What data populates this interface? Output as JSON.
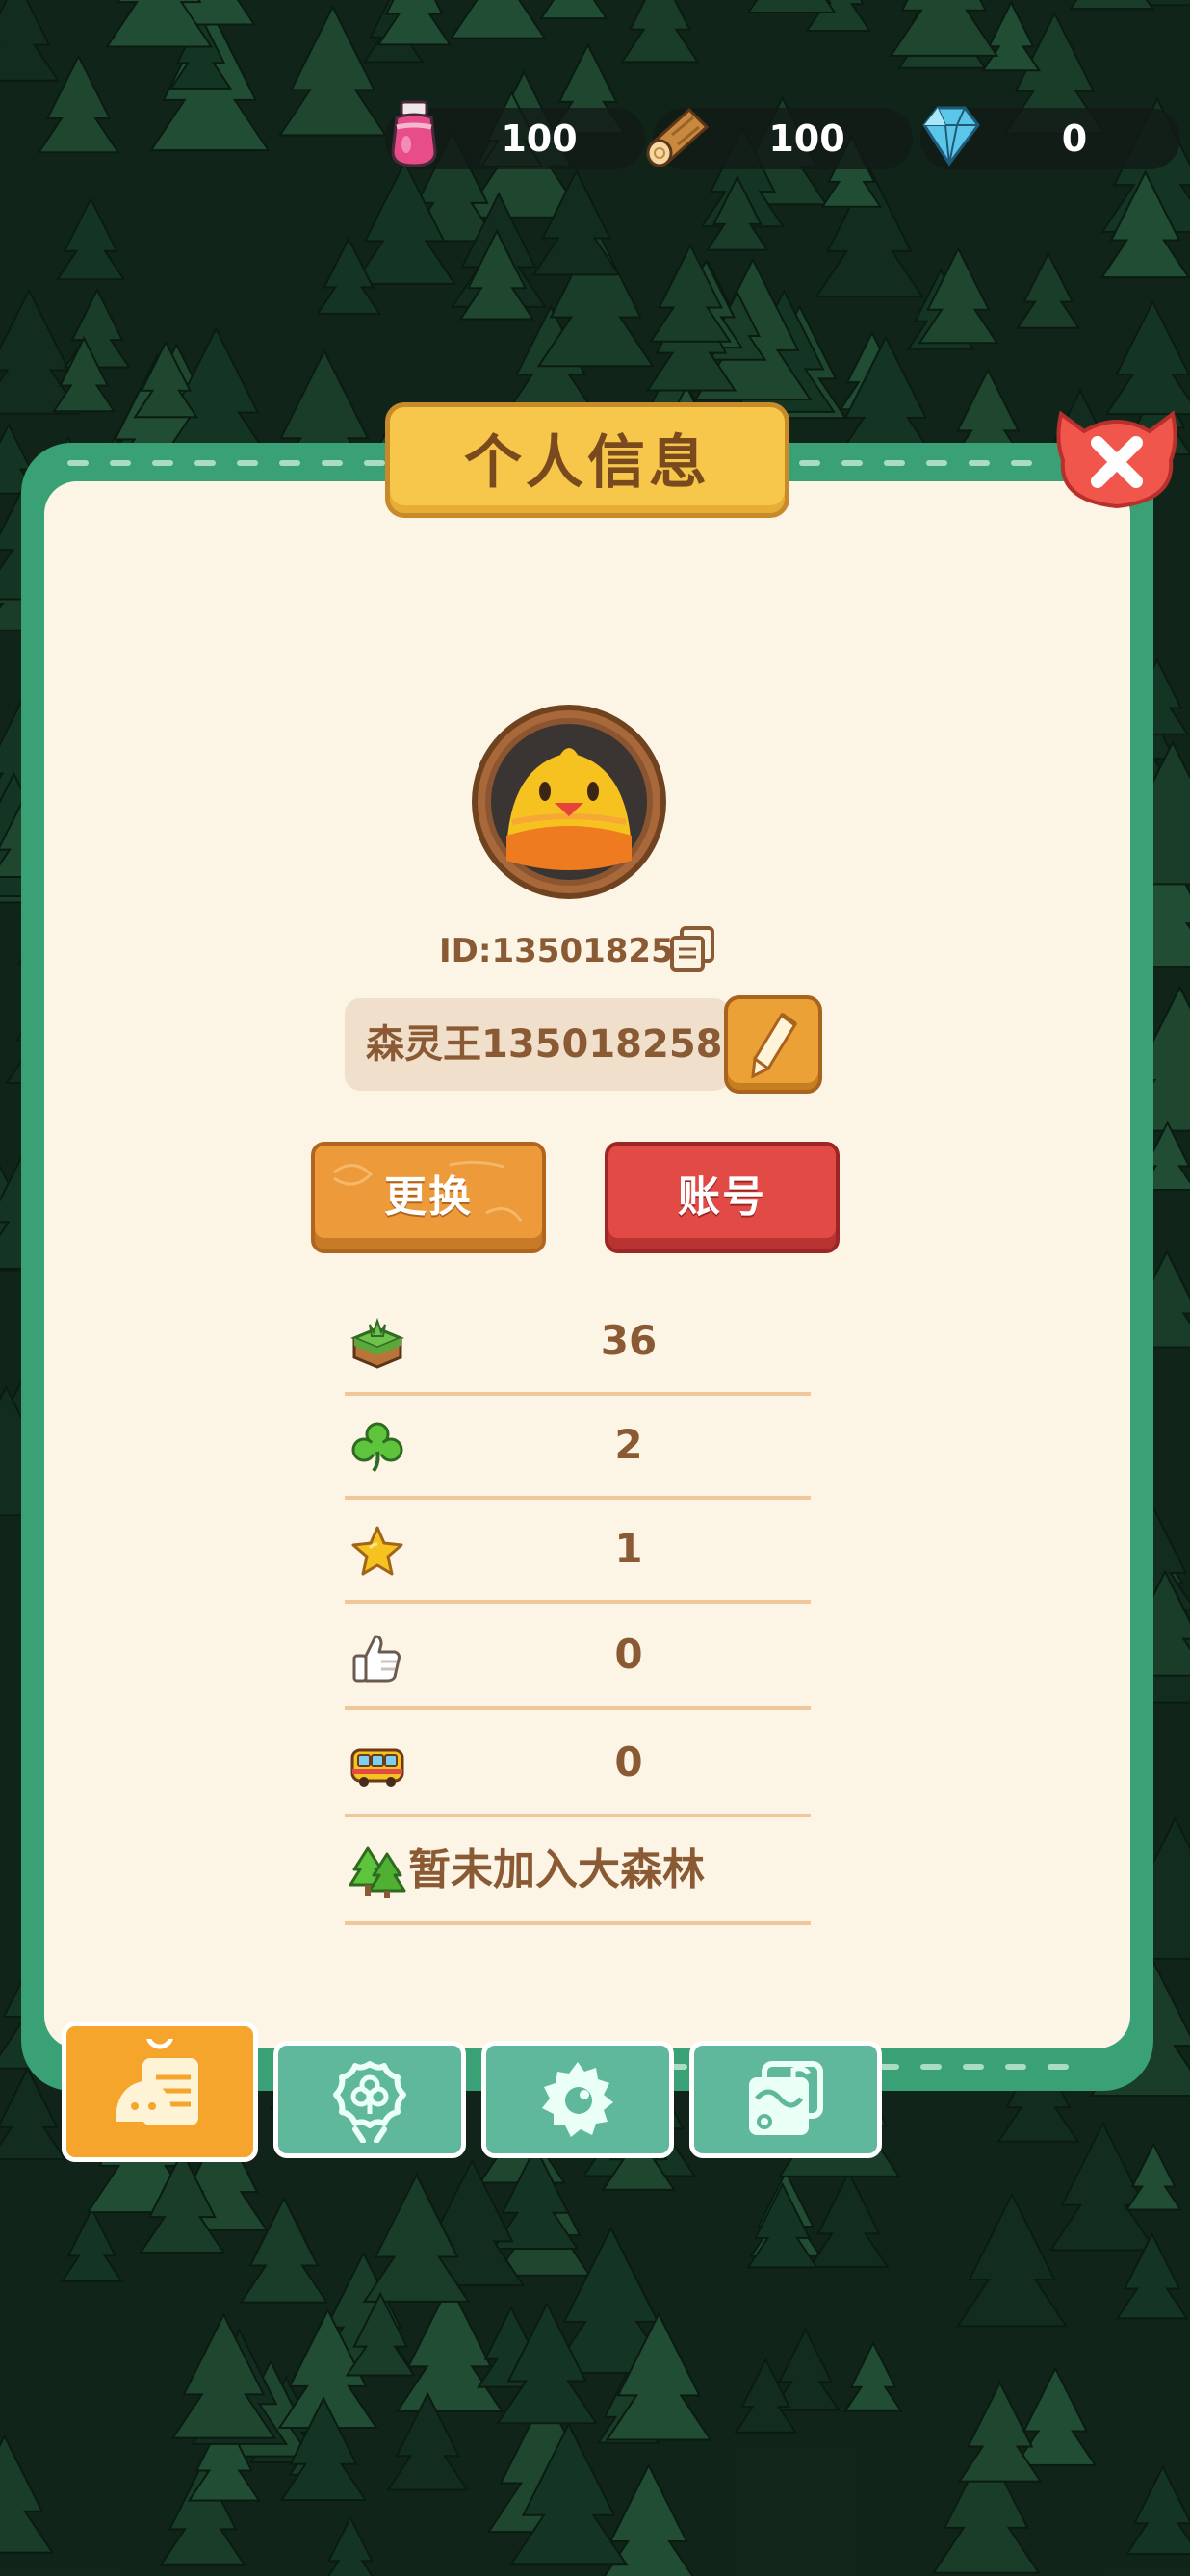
{
  "resources": {
    "potion": {
      "icon": "pink-potion-icon",
      "value": "100"
    },
    "wood": {
      "icon": "wood-log-icon",
      "value": "100"
    },
    "diamond": {
      "icon": "blue-diamond-icon",
      "value": "0"
    }
  },
  "panel": {
    "title": "个人信息",
    "close_icon": "close-icon"
  },
  "profile": {
    "avatar_icon": "yellow-bird-avatar",
    "id_text": "ID:135018258",
    "copy_icon": "copy-icon",
    "name": "森灵王135018258",
    "edit_icon": "pencil-icon"
  },
  "buttons": {
    "change_label": "更换",
    "account_label": "账号"
  },
  "stats": [
    {
      "icon": "grass-block-icon",
      "value": "36"
    },
    {
      "icon": "clover-icon",
      "value": "2"
    },
    {
      "icon": "star-icon",
      "value": "1"
    },
    {
      "icon": "thumbs-up-icon",
      "value": "0"
    },
    {
      "icon": "bus-icon",
      "value": "0"
    }
  ],
  "forest_status": {
    "icon": "pine-trees-icon",
    "text": "暂未加入大森林"
  },
  "tabs": [
    {
      "icon": "profile-card-icon",
      "selected": true
    },
    {
      "icon": "flower-badge-icon",
      "selected": false
    },
    {
      "icon": "gear-icon",
      "selected": false
    },
    {
      "icon": "photo-album-icon",
      "selected": false
    }
  ],
  "colors": {
    "frame_green": "#3aa076",
    "panel_cream": "#fcf4e4",
    "text_brown": "#8a5a35",
    "title_yellow": "#f6c74a",
    "button_orange": "#ec9a3a",
    "button_red": "#e24a45",
    "tab_teal": "#5fb89b",
    "tab_active": "#f5a52c"
  }
}
